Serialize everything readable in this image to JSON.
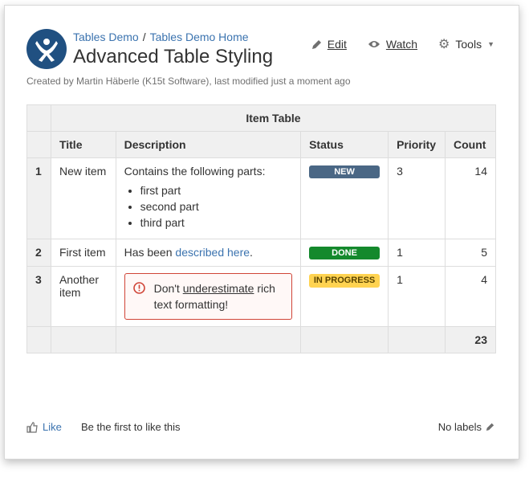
{
  "breadcrumb": [
    "Tables Demo",
    "Tables Demo Home"
  ],
  "breadcrumb_sep": "/",
  "page_title": "Advanced Table Styling",
  "meta": "Created by Martin Häberle (K15t Software), last modified just a moment ago",
  "actions": {
    "edit": "Edit",
    "watch": "Watch",
    "tools": "Tools"
  },
  "table": {
    "caption": "Item Table",
    "headers": [
      "Title",
      "Description",
      "Status",
      "Priority",
      "Count"
    ],
    "rows": [
      {
        "num": "1",
        "title": "New item",
        "desc": "Contains the following parts:",
        "parts": [
          "first part",
          "second part",
          "third part"
        ],
        "status": "NEW",
        "priority": "3",
        "count": "14"
      },
      {
        "num": "2",
        "title": "First item",
        "desc_pre": "Has been ",
        "desc_link": "described here",
        "desc_post": ".",
        "status": "DONE",
        "priority": "1",
        "count": "5"
      },
      {
        "num": "3",
        "title": "Another item",
        "warn_pre": "Don't ",
        "warn_u": "underestimate",
        "warn_post": " rich text formatting!",
        "status": "IN PROGRESS",
        "priority": "1",
        "count": "4"
      }
    ],
    "total": "23"
  },
  "footer": {
    "like": "Like",
    "first_like": "Be the first to like this",
    "labels": "No labels"
  },
  "colors": {
    "brand": "#205081",
    "link": "#3b73af",
    "new": "#4a6785",
    "done": "#14892c",
    "progress": "#ffd351",
    "warning": "#d04437"
  }
}
